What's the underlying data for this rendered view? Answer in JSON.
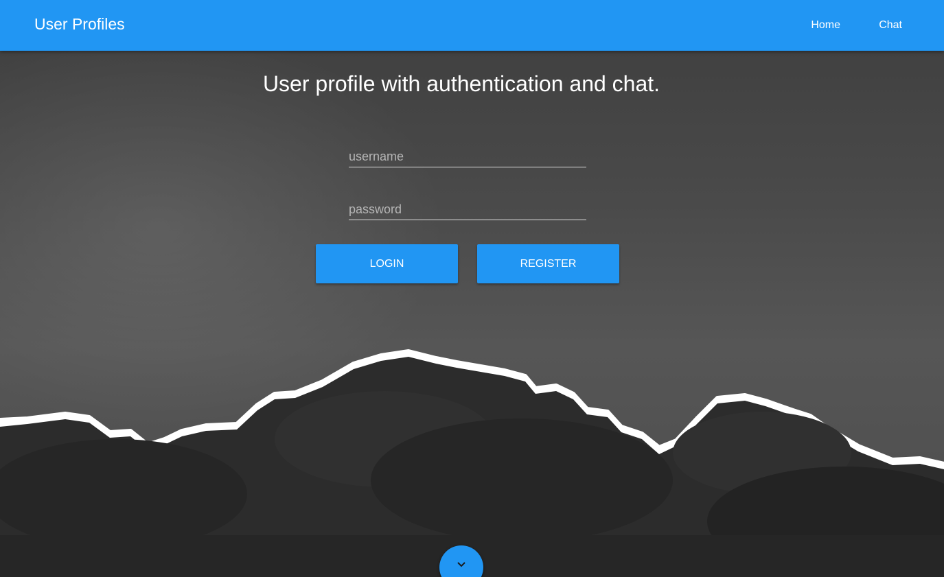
{
  "header": {
    "brand": "User Profiles",
    "nav": [
      {
        "label": "Home"
      },
      {
        "label": "Chat"
      }
    ]
  },
  "hero": {
    "headline": "User profile with authentication and chat."
  },
  "form": {
    "username_placeholder": "username",
    "password_placeholder": "password",
    "login_label": "LOGIN",
    "register_label": "REGISTER"
  },
  "scroll_button": {
    "icon": "chevron-down-icon"
  },
  "colors": {
    "primary": "#2196f3",
    "text": "#ffffff",
    "field_underline": "#e0e0e0",
    "placeholder": "#b5b5b5"
  }
}
